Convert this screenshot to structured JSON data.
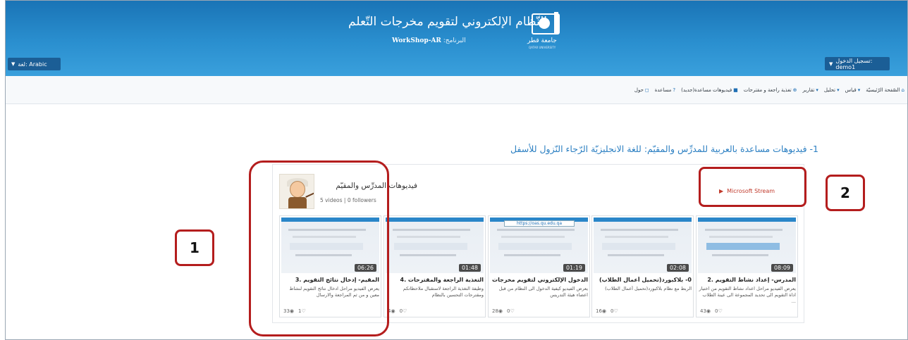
{
  "header": {
    "title": "النّظام الإلكتروني لتقويم مخرجات التّعلم",
    "program_label": "البرنامج:",
    "program_value": "WorkShop-AR",
    "logo_name": "جامعة قطر",
    "logo_sub": "QATAR UNIVERSITY",
    "language_button": "لغة: Arabic",
    "user_button": "تسجيل الدخول: demo1"
  },
  "nav": [
    {
      "label": "الصّفحة الرّئيسيّة",
      "icon": "home-icon",
      "glyph": "⌂"
    },
    {
      "label": "قياس",
      "icon": "caret-icon",
      "glyph": "▾"
    },
    {
      "label": "تحليل",
      "icon": "caret-icon",
      "glyph": "▾"
    },
    {
      "label": "تقارير",
      "icon": "caret-icon",
      "glyph": "▾"
    },
    {
      "label": "تغذية راجعة و مقترحات",
      "icon": "feedback-icon",
      "glyph": "⊕"
    },
    {
      "label": "فيديوهات مساعدة(جديد)",
      "icon": "video-icon",
      "glyph": "■"
    },
    {
      "label": "مساعدة",
      "icon": "help-icon",
      "glyph": "?"
    },
    {
      "label": "حول",
      "icon": "info-icon",
      "glyph": "◻"
    }
  ],
  "section_heading": "1- فيديوهات مساعدة بالعربية للمدرِّس والمقيّم: للغة الانجليزيّة الرّجاء النّزول للأسفل",
  "channel": {
    "name": "فيديوهات المدرِّس والمقيّم",
    "stats": "5 videos | 0 followers",
    "provider": "Microsoft Stream"
  },
  "videos": [
    {
      "title": "المقيم- إدخال نتائج التقويم .3",
      "desc": "يعرض الفيديو مراحل ادخال نتائج التقويم لنشاط معين و من ثم المراجعة والارسال",
      "duration": "06:26",
      "views": "33",
      "likes": "1"
    },
    {
      "title": "التغذية الراجعة والمقترحات .4",
      "desc": "وظيفة التغذية الراجعة لاستقبال ملاحظاتكم ومقترحات التحسين بالنظام",
      "duration": "01:48",
      "views": "4",
      "likes": "0"
    },
    {
      "title": "الدخول الإلكتروني لتقويم مخرجات التعلم .1",
      "desc": "يعرض الفيديو كيفية الدخول الى النظام من قبل اعضاء هيئة التدريس",
      "duration": "01:19",
      "views": "28",
      "likes": "0"
    },
    {
      "title": "0- بلاكبورد(تحميل أعمال الطلاب)",
      "desc": "الربط مع نظام بلاكبورد(تحميل أعمال الطلاب)",
      "duration": "02:08",
      "views": "16",
      "likes": "0"
    },
    {
      "title": "المدرس- إعداد نشاط التقويم .2",
      "desc": "يعرض الفيديو مراحل اعداد نشاط التقويم من اختيار اداة التقويم الى تحديد المجموعة الى عينة الطلاب ...",
      "duration": "08:09",
      "views": "43",
      "likes": "0"
    }
  ],
  "callouts": {
    "one": "1",
    "two": "2"
  },
  "colors": {
    "header": "#2a8fcf",
    "nav_button": "#1b5e96",
    "heading": "#2b7fc2",
    "callout": "#b41d1d",
    "stream": "#c0392b"
  }
}
